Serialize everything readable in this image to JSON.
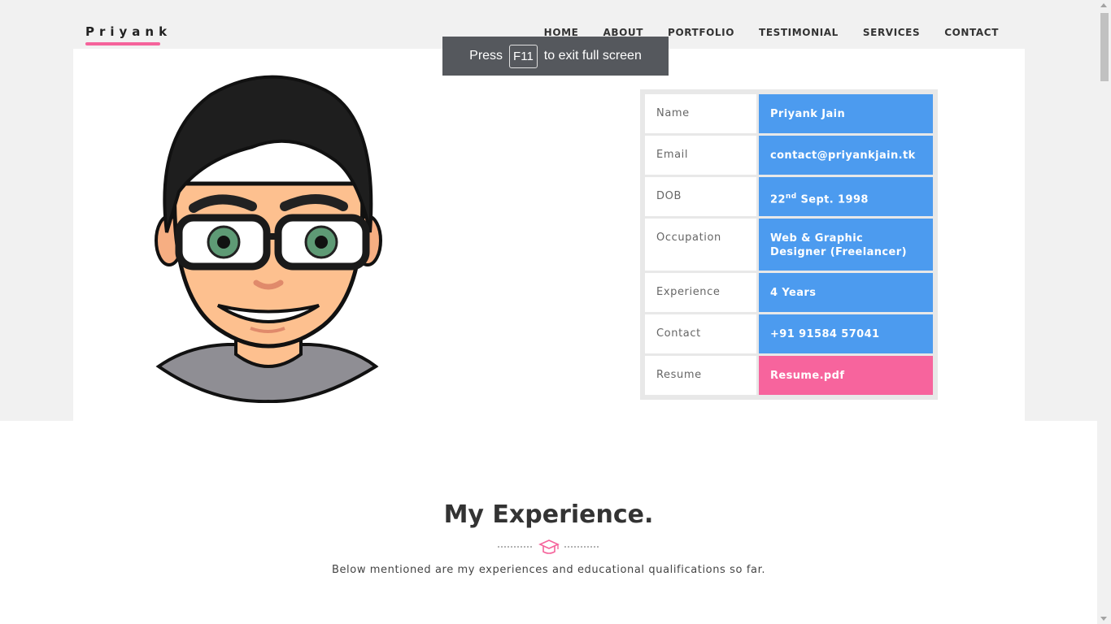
{
  "header": {
    "logo": "Priyank",
    "nav": [
      "HOME",
      "ABOUT",
      "PORTFOLIO",
      "TESTIMONIAL",
      "SERVICES",
      "CONTACT"
    ]
  },
  "fullscreen_toast": {
    "press": "Press",
    "key": "F11",
    "rest": "to exit full screen"
  },
  "info": {
    "rows": [
      {
        "label": "Name",
        "value": "Priyank Jain"
      },
      {
        "label": "Email",
        "value": "contact@priyankjain.tk"
      },
      {
        "label": "DOB",
        "value_prefix": "22",
        "value_sup": "nd",
        "value_suffix": " Sept. 1998"
      },
      {
        "label": "Occupation",
        "value": "Web & Graphic Designer (Freelancer)"
      },
      {
        "label": "Experience",
        "value": "4 Years"
      },
      {
        "label": "Contact",
        "value": "+91 91584 57041"
      },
      {
        "label": "Resume",
        "value": "Resume.pdf"
      }
    ]
  },
  "experience": {
    "title": "My Experience.",
    "icon": "graduation-cap-icon",
    "subtitle": "Below mentioned are my experiences and educational qualifications so far."
  },
  "colors": {
    "accent_pink": "#f5639b",
    "info_blue": "#4c9bef"
  }
}
